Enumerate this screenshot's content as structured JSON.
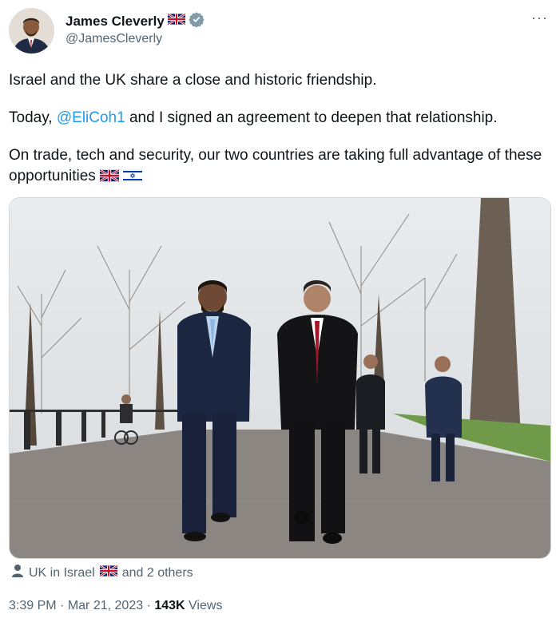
{
  "author": {
    "name": "James Cleverly",
    "handle": "@JamesCleverly",
    "verified_icon": "verified-badge-icon",
    "flag_icon": "uk-flag-icon"
  },
  "more_label": "···",
  "tweet": {
    "line1": "Israel and the UK share a close and historic friendship.",
    "line2_prefix": "Today, ",
    "line2_mention": "@EliCoh1",
    "line2_suffix": " and I signed an agreement to deepen that relationship.",
    "line3": "On trade, tech and security, our two countries are taking full advantage of these opportunities",
    "flags": [
      "uk-flag-icon",
      "israel-flag-icon"
    ]
  },
  "photo": {
    "alt": "Two men in suits walking along a tree-lined avenue"
  },
  "tagged": {
    "prefix": "UK in Israel",
    "suffix": "and 2 others"
  },
  "meta": {
    "time": "3:39 PM",
    "date": "Mar 21, 2023",
    "views_count": "143K",
    "views_label": "Views"
  },
  "colors": {
    "link": "#1d9bf0",
    "secondary": "#536471",
    "verified": "#829aab"
  }
}
